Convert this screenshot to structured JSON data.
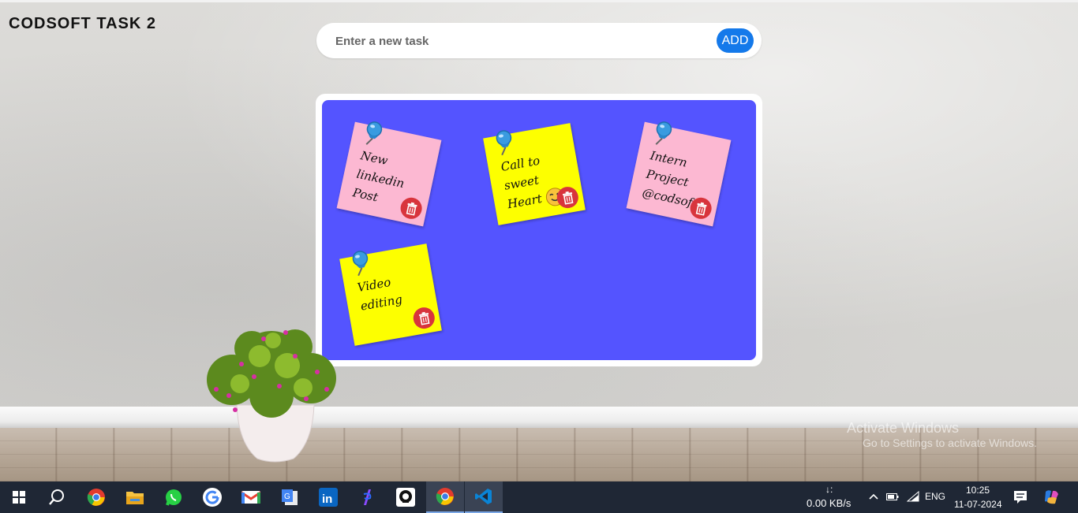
{
  "app": {
    "title": "CODSOFT TASK 2"
  },
  "task_form": {
    "placeholder": "Enter a new task",
    "value": "",
    "add_label": "ADD"
  },
  "notes": [
    {
      "text_line1": "New linkedin",
      "text_line2": "Post",
      "color": "#fcb8d2"
    },
    {
      "text_line1": "Call to sweet",
      "text_line2": "Heart",
      "color": "#fdff00"
    },
    {
      "text_line1": "Intern Project",
      "text_line2": "@codsoft",
      "color": "#fcb8d2"
    },
    {
      "text_line1": "Video editing",
      "text_line2": "",
      "color": "#fdff00"
    }
  ],
  "colors": {
    "board": "#5454ff",
    "add_button": "#1479ea",
    "delete_button": "#d8343c",
    "taskbar": "#1f2735"
  },
  "watermark": {
    "line1": "Activate Windows",
    "line2": "Go to Settings to activate Windows."
  },
  "taskbar": {
    "apps": [
      "windows-start",
      "search",
      "chrome",
      "file-explorer",
      "whatsapp",
      "google",
      "gmail",
      "google-translate",
      "linkedin",
      "app",
      "github",
      "chrome",
      "vscode"
    ],
    "network_arrow": "↓:",
    "network_speed": "0.00 KB/s",
    "language": "ENG",
    "time": "10:25",
    "date": "11-07-2024"
  }
}
